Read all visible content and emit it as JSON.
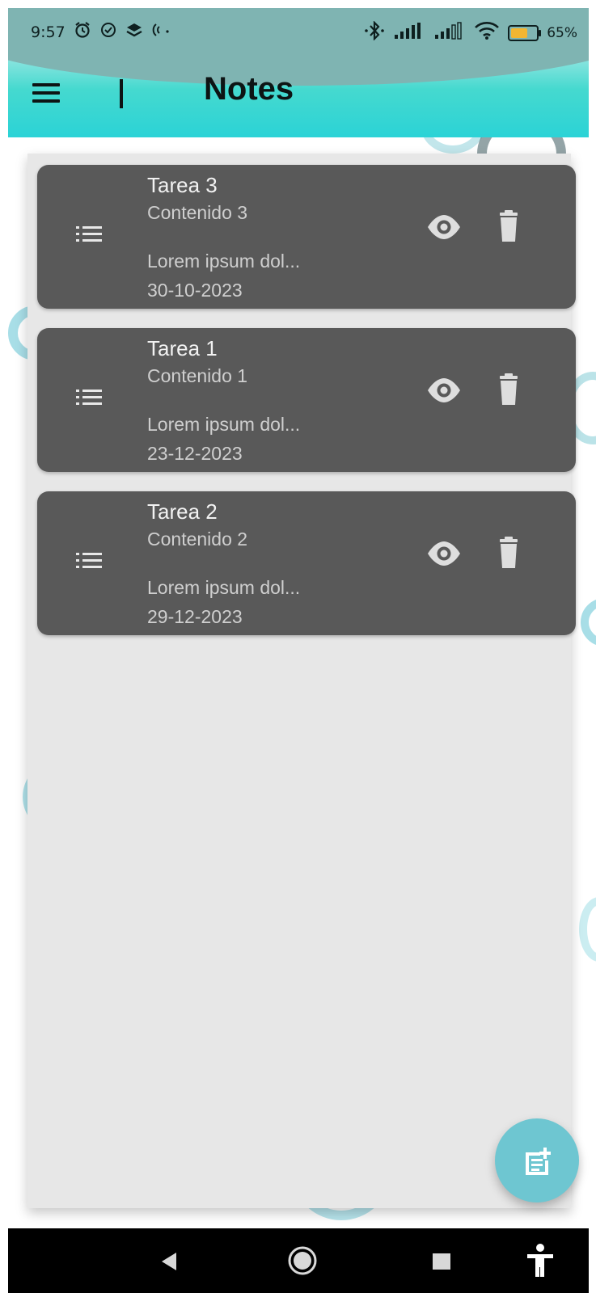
{
  "status_bar": {
    "time": "9:57",
    "battery_percent": "65%",
    "battery_level": 0.65,
    "icons": [
      "alarm-icon",
      "check-circle-icon",
      "layers-icon",
      "nfc-icon",
      "bluetooth-icon",
      "signal-icon",
      "signal-icon-2",
      "wifi-icon",
      "battery-icon"
    ]
  },
  "app_bar": {
    "title": "Notes"
  },
  "notes": [
    {
      "title": "Tarea 3",
      "content": "Contenido 3",
      "description": "Lorem ipsum dol...",
      "date": "30-10-2023"
    },
    {
      "title": "Tarea 1",
      "content": "Contenido 1",
      "description": "Lorem ipsum dol...",
      "date": "23-12-2023"
    },
    {
      "title": "Tarea 2",
      "content": "Contenido 2",
      "description": "Lorem ipsum dol...",
      "date": "29-12-2023"
    }
  ],
  "colors": {
    "accent": "#2bd3d6",
    "card": "#595959",
    "panel": "#e7e7e7",
    "fab": "#6ec6d1"
  }
}
